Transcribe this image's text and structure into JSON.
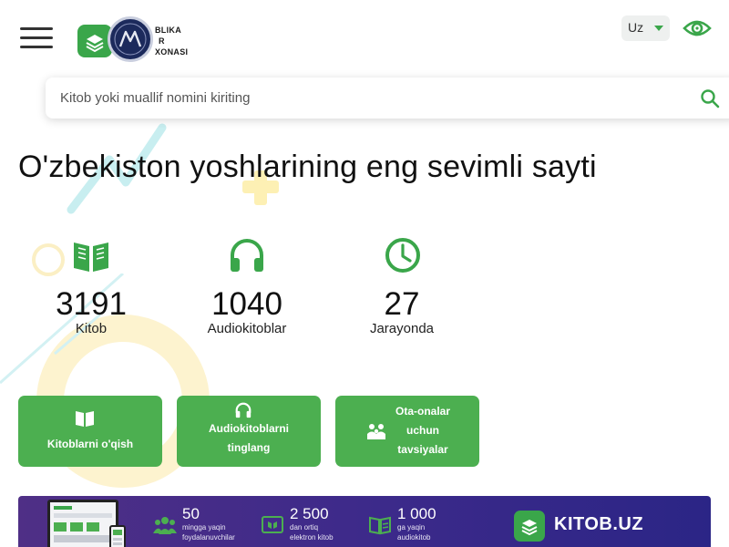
{
  "header": {
    "logo_text_lines": [
      "BLIKA",
      "R",
      "XONASI"
    ],
    "language": "Uz",
    "colors": {
      "accent": "#3aa64a",
      "seal": "#1c2a5c"
    }
  },
  "search": {
    "placeholder": "Kitob yoki muallif nomini kiriting",
    "value": ""
  },
  "hero": {
    "title": "O'zbekiston yoshlarining eng sevimli sayti"
  },
  "stats": [
    {
      "icon": "book-open-icon",
      "value": "3191",
      "label": "Kitob"
    },
    {
      "icon": "headphones-icon",
      "value": "1040",
      "label": "Audiokitoblar"
    },
    {
      "icon": "clock-icon",
      "value": "27",
      "label": "Jarayonda"
    }
  ],
  "actions": [
    {
      "icon": "book-open-icon",
      "lines": [
        "Kitoblarni o'qish"
      ]
    },
    {
      "icon": "headphones-icon",
      "lines": [
        "Audiokitoblarni",
        "tinglang"
      ]
    },
    {
      "icon": "family-icon",
      "lines": [
        "Ota-onalar",
        "uchun",
        "tavsiyalar"
      ]
    }
  ],
  "banner": {
    "stats": [
      {
        "icon": "users-icon",
        "value": "50",
        "lines": [
          "mingga yaqin",
          "foydalanuvchilar"
        ]
      },
      {
        "icon": "ebook-icon",
        "value": "2 500",
        "lines": [
          "dan ortiq",
          "elektron kitob"
        ]
      },
      {
        "icon": "audiobook-icon",
        "value": "1 000",
        "lines": [
          "ga yaqin",
          "audiokitob"
        ]
      }
    ],
    "brand": "KITOB.UZ"
  }
}
